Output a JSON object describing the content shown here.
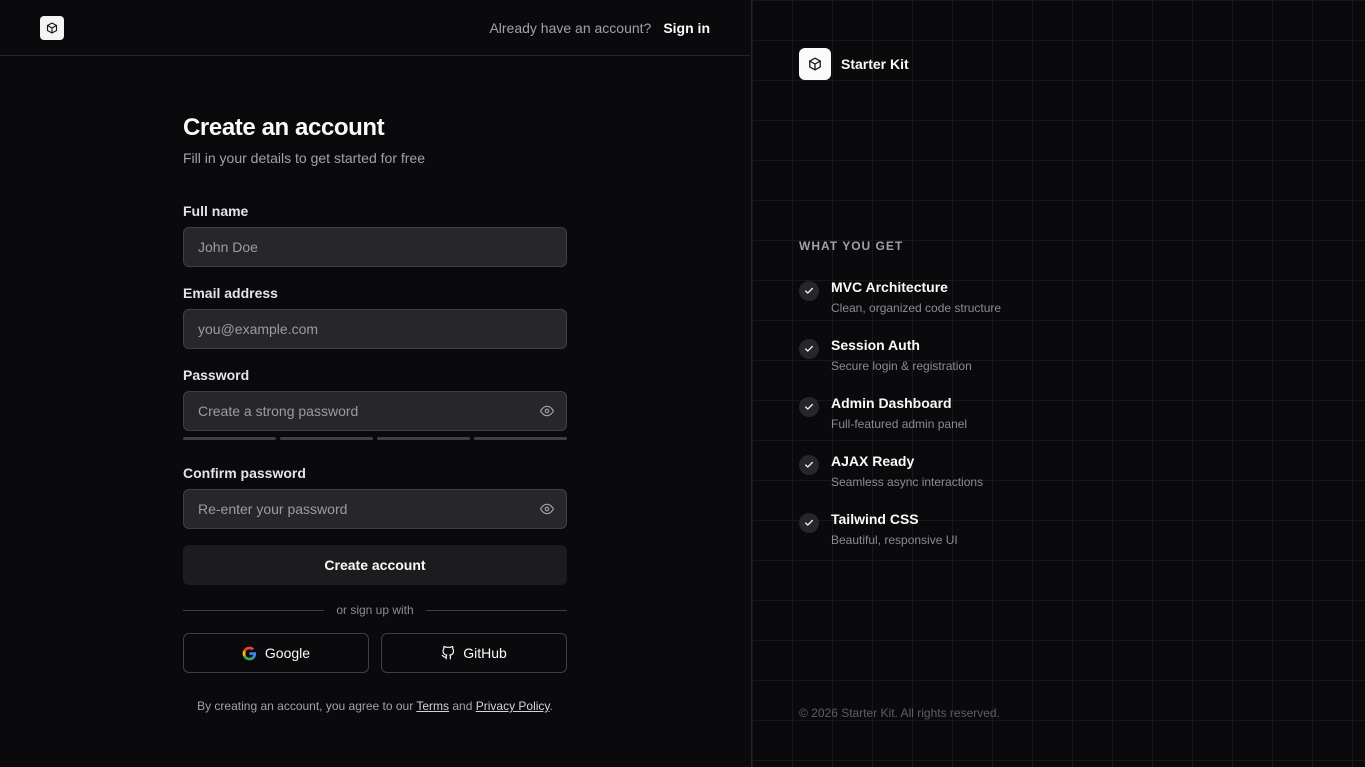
{
  "topbar": {
    "prompt": "Already have an account?",
    "signin_label": "Sign in"
  },
  "form": {
    "title": "Create an account",
    "subtitle": "Fill in your details to get started for free",
    "full_name": {
      "label": "Full name",
      "placeholder": "John Doe",
      "value": ""
    },
    "email": {
      "label": "Email address",
      "placeholder": "you@example.com",
      "value": ""
    },
    "password": {
      "label": "Password",
      "placeholder": "Create a strong password",
      "value": "",
      "strength_segments_filled": 0,
      "strength_segments_total": 4
    },
    "confirm_password": {
      "label": "Confirm password",
      "placeholder": "Re-enter your password",
      "value": ""
    },
    "submit_label": "Create account",
    "divider_text": "or sign up with",
    "google_label": "Google",
    "github_label": "GitHub",
    "terms_prefix": "By creating an account, you agree to our",
    "terms_link": "Terms",
    "terms_and": "and",
    "privacy_link": "Privacy Policy",
    "terms_suffix": "."
  },
  "sidebar": {
    "brand_name": "Starter Kit",
    "features_heading": "WHAT YOU GET",
    "features": [
      {
        "title": "MVC Architecture",
        "desc": "Clean, organized code structure"
      },
      {
        "title": "Session Auth",
        "desc": "Secure login & registration"
      },
      {
        "title": "Admin Dashboard",
        "desc": "Full-featured admin panel"
      },
      {
        "title": "AJAX Ready",
        "desc": "Seamless async interactions"
      },
      {
        "title": "Tailwind CSS",
        "desc": "Beautiful, responsive UI"
      }
    ],
    "copyright": "© 2026 Starter Kit. All rights reserved."
  },
  "colors": {
    "background": "#0a0a0c",
    "input_bg": "#27272a",
    "border": "#3f3f46",
    "text": "#fafafa",
    "muted": "#a1a1aa"
  },
  "icons": {
    "logo": "cube-icon",
    "password_toggle": "eye-icon",
    "feature_check": "check-icon",
    "google": "google-icon",
    "github": "github-icon"
  }
}
